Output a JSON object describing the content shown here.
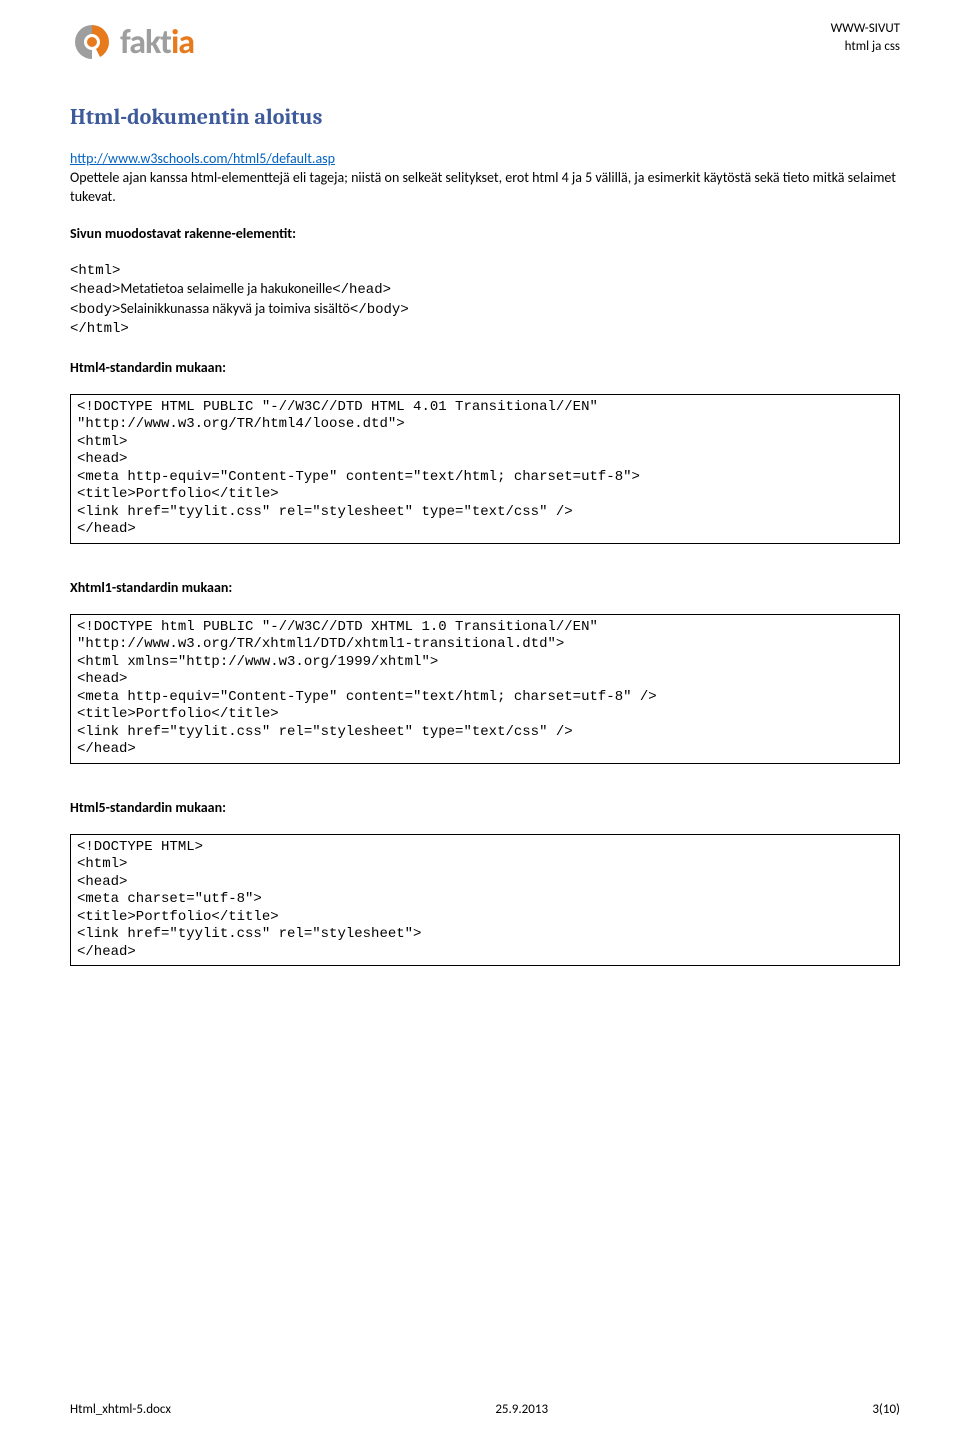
{
  "header": {
    "brand_gray": "fakt",
    "brand_orange": "ia",
    "r1": "WWW-SIVUT",
    "r2": "html ja css"
  },
  "title": "Html-dokumentin aloitus",
  "link_url": "http://www.w3schools.com/html5/default.asp",
  "intro": "Opettele ajan kanssa html-elementtejä eli tageja; niistä on selkeät selitykset, erot html 4 ja 5 välillä, ja esimerkit käytöstä sekä tieto mitkä selaimet tukevat.",
  "struct_heading": "Sivun muodostavat rakenne-elementit:",
  "struct_lines": {
    "l1_pre": "<html>",
    "l2_open": "<head>",
    "l2_text": "Metatietoa selaimelle ja hakukoneille",
    "l2_close": "</head>",
    "l3_open": "<body>",
    "l3_text": "Selainikkunassa näkyvä ja toimiva sisältö",
    "l3_close": "</body>",
    "l4": "</html>"
  },
  "h_html4": "Html4-standardin mukaan:",
  "code_html4": "<!DOCTYPE HTML PUBLIC \"-//W3C//DTD HTML 4.01 Transitional//EN\"\n\"http://www.w3.org/TR/html4/loose.dtd\">\n<html>\n<head>\n<meta http-equiv=\"Content-Type\" content=\"text/html; charset=utf-8\">\n<title>Portfolio</title>\n<link href=\"tyylit.css\" rel=\"stylesheet\" type=\"text/css\" />\n</head>",
  "h_xhtml1": "Xhtml1-standardin mukaan:",
  "code_xhtml1": "<!DOCTYPE html PUBLIC \"-//W3C//DTD XHTML 1.0 Transitional//EN\"\n\"http://www.w3.org/TR/xhtml1/DTD/xhtml1-transitional.dtd\">\n<html xmlns=\"http://www.w3.org/1999/xhtml\">\n<head>\n<meta http-equiv=\"Content-Type\" content=\"text/html; charset=utf-8\" />\n<title>Portfolio</title>\n<link href=\"tyylit.css\" rel=\"stylesheet\" type=\"text/css\" />\n</head>",
  "h_html5": "Html5-standardin mukaan:",
  "code_html5": "<!DOCTYPE HTML>\n<html>\n<head>\n<meta charset=\"utf-8\">\n<title>Portfolio</title>\n<link href=\"tyylit.css\" rel=\"stylesheet\">\n</head>",
  "footer": {
    "left": "Html_xhtml-5.docx",
    "center": "25.9.2013",
    "right": "3(10)"
  }
}
